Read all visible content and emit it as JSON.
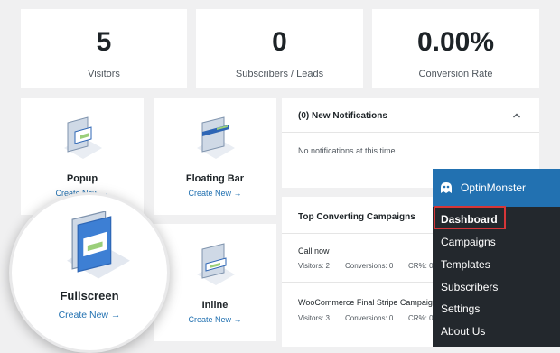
{
  "stats": [
    {
      "value": "5",
      "label": "Visitors"
    },
    {
      "value": "0",
      "label": "Subscribers / Leads"
    },
    {
      "value": "0.00%",
      "label": "Conversion Rate"
    }
  ],
  "tiles": {
    "popup": {
      "title": "Popup",
      "link": "Create New →"
    },
    "floating_bar": {
      "title": "Floating Bar",
      "link": "Create New →"
    },
    "fullscreen": {
      "title": "Fullscreen",
      "link": "Create New →"
    },
    "inline": {
      "title": "Inline",
      "link": "Create New →"
    }
  },
  "notifications": {
    "title": "(0) New Notifications",
    "empty_text": "No notifications at this time."
  },
  "campaigns": {
    "title": "Top Converting Campaigns",
    "items": [
      {
        "name": "Call now",
        "visitors": "Visitors: 2",
        "conversions": "Conversions: 0",
        "cr": "CR%: 0"
      },
      {
        "name": "WooCommerce Final Stripe Campaign",
        "visitors": "Visitors: 3",
        "conversions": "Conversions: 0",
        "cr": "CR%: 0"
      }
    ]
  },
  "menu": {
    "title": "OptinMonster",
    "items": [
      "Dashboard",
      "Campaigns",
      "Templates",
      "Subscribers",
      "Settings",
      "About Us"
    ],
    "active_index": 0
  },
  "colors": {
    "accent": "#2271b1",
    "menu_bg": "#23282d",
    "highlight": "#d63638"
  },
  "icons": {
    "chevron": "chevron-up-icon",
    "logo": "optinmonster-logo-icon",
    "campaign": "campaign-type-icon"
  }
}
